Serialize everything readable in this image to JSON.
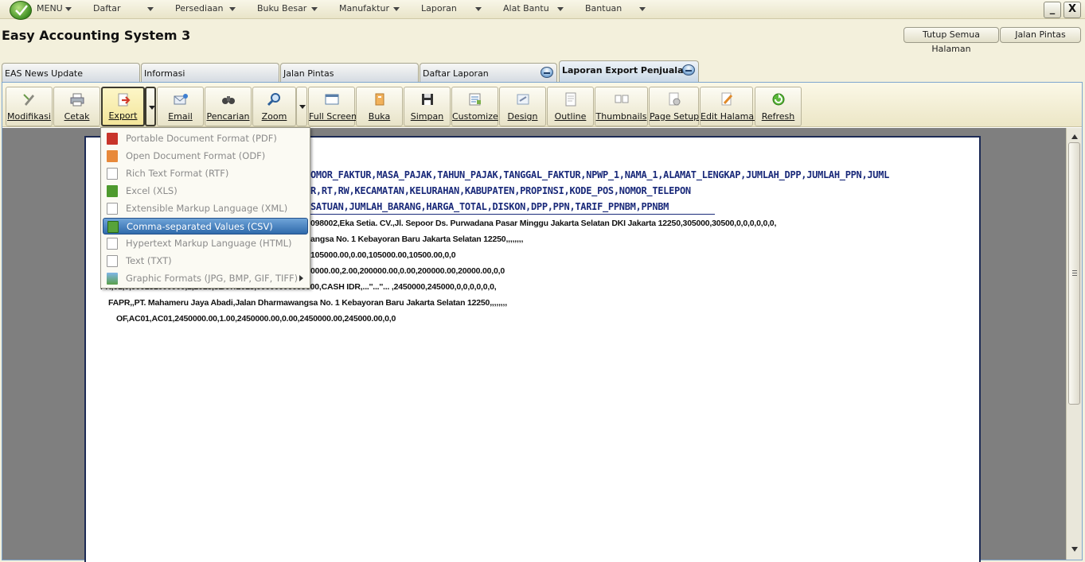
{
  "menubar": {
    "menu_label": "MENU",
    "items": [
      "Daftar",
      "Persediaan",
      "Buku Besar",
      "Manufaktur",
      "Laporan",
      "Alat Bantu",
      "Bantuan"
    ],
    "minimize_label": "_",
    "close_label": "X"
  },
  "app_title": "Easy Accounting System 3",
  "top_buttons": {
    "close_all": "Tutup Semua Halaman",
    "shortcuts": "Jalan Pintas"
  },
  "tabs": [
    "EAS News Update",
    "Informasi",
    "Jalan Pintas",
    "Daftar Laporan",
    "Laporan Export Penjuala..."
  ],
  "active_tab": "Laporan Export Penjuala...",
  "toolbar": {
    "modifikasi": "Modifikasi",
    "cetak": "Cetak",
    "export": "Export",
    "email": "Email",
    "pencarian": "Pencarian",
    "zoom": "Zoom",
    "full_screen": "Full Screen",
    "buka": "Buka",
    "simpan": "Simpan",
    "customize": "Customize",
    "design": "Design",
    "outline": "Outline",
    "thumbnails": "Thumbnails",
    "page_setup": "Page Setup",
    "edit_halaman": "Edit Halaman",
    "refresh": "Refresh"
  },
  "export_menu": [
    {
      "label": "Portable Document Format (PDF)",
      "icon": "pdf-file-icon"
    },
    {
      "label": "Open Document Format (ODF)",
      "icon": "odf-file-icon"
    },
    {
      "label": "Rich Text Format (RTF)",
      "icon": "rtf-file-icon"
    },
    {
      "label": "Excel (XLS)",
      "icon": "xls-file-icon"
    },
    {
      "label": "Extensible Markup Language (XML)",
      "icon": "xml-file-icon"
    },
    {
      "label": "Comma-separated Values (CSV)",
      "icon": "csv-file-icon",
      "selected": true
    },
    {
      "label": "Hypertext Markup Language (HTML)",
      "icon": "html-file-icon"
    },
    {
      "label": "Text (TXT)",
      "icon": "txt-file-icon"
    },
    {
      "label": "Graphic Formats (JPG, BMP, GIF, TIFF)",
      "icon": "image-file-icon",
      "has_submenu": true
    }
  ],
  "report_lines": [
    "OMOR_FAKTUR,MASA_PAJAK,TAHUN_PAJAK,TANGGAL_FAKTUR,NPWP_1,NAMA_1,ALAMAT_LENGKAP,JUMLAH_DPP,JUMLAH_PPN,JUML",
    "R,RT,RW,KECAMATAN,KELURAHAN,KABUPATEN,PROPINSI,KODE_POS,NOMOR_TELEPON",
    "SATUAN,JUMLAH_BARANG,HARGA_TOTAL,DISKON,DPP,PPN,TARIF_PPNBM,PPNBM",
    "098002,Eka Setia. CV.,Jl. Sepoor Ds. Purwadana Pasar Minggu Jakarta Selatan DKI Jakarta 12250,305000,30500,0,0,0,0,0,0,",
    "angsa No. 1 Kebayoran Baru Jakarta Selatan 12250,,,,,,,,",
    "105000.00,0.00,105000.00,10500.00,0,0",
    "0000.00,2.00,200000.00,0.00,200000.00,20000.00,0,0",
    "FK,01,0,000151000000,1,2015,31/07/2015,00000000099000,CASH IDR,...''...''...   ,2450000,245000,0,0,0,0,0,0,",
    "FAPR,,PT. Mahameru Jaya Abadi,Jalan Dharmawangsa No. 1 Kebayoran Baru Jakarta Selatan 12250,,,,,,,,",
    "OF,AC01,AC01,2450000.00,1.00,2450000.00,0.00,2450000.00,245000.00,0,0"
  ],
  "colors": {
    "accent_blue": "#2f6aab",
    "report_header": "#1a2a7a",
    "toolbar_bg": "#ece6c6"
  }
}
